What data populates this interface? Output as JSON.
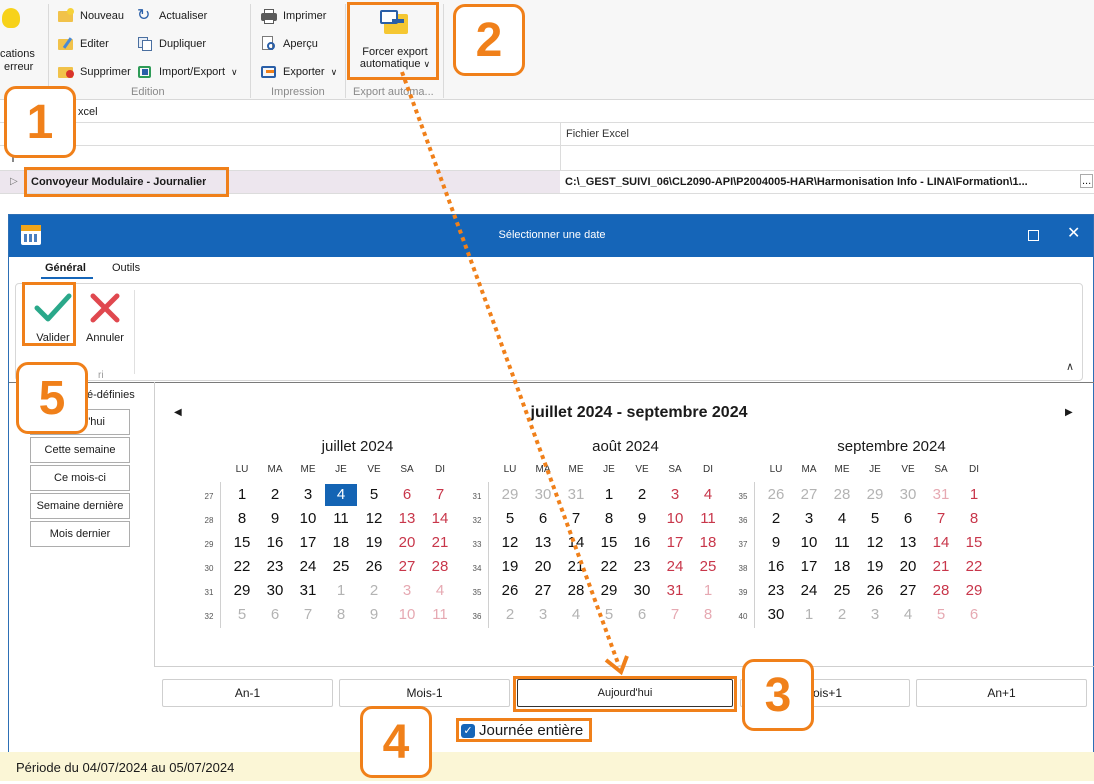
{
  "ribbon": {
    "left_btn_line1": "cations",
    "left_btn_line2": "erreur",
    "edition": {
      "nouveau": "Nouveau",
      "editer": "Editer",
      "supprimer": "Supprimer",
      "actualiser": "Actualiser",
      "dupliquer": "Dupliquer",
      "import_export": "Import/Export",
      "group_label": "Edition"
    },
    "impression": {
      "imprimer": "Imprimer",
      "apercu": "Aperçu",
      "exporter": "Exporter",
      "group_label": "Impression"
    },
    "export_auto": {
      "line1": "Forcer export",
      "line2": "automatique",
      "group_label": "Export automa..."
    }
  },
  "grid": {
    "filter_text": "xcel",
    "col_fichier": "Fichier Excel",
    "row_name": "Convoyeur Modulaire - Journalier",
    "row_path": "C:\\_GEST_SUIVI_06\\CL2090-API\\P2004005-HAR\\Harmonisation Info - LINA\\Formation\\1...",
    "row_more": "..."
  },
  "dialog": {
    "title": "Sélectionner une date",
    "tab_general": "Général",
    "tab_outils": "Outils",
    "valider": "Valider",
    "annuler": "Annuler",
    "group_frag": "ri",
    "predefined_header": "é-définies",
    "quick_buttons": [
      "l'hui",
      "Cette semaine",
      "Ce mois-ci",
      "Semaine dernière",
      "Mois dernier"
    ],
    "range_title": "juillet 2024 - septembre 2024",
    "weekdays": [
      "LU",
      "MA",
      "ME",
      "JE",
      "VE",
      "SA",
      "DI"
    ],
    "nav": {
      "an_minus": "An-1",
      "mois_minus": "Mois-1",
      "aujourdhui": "Aujourd'hui",
      "mois_plus": "ois+1",
      "an_plus": "An+1"
    },
    "journee_entiere": "Journée entière",
    "status": "Période du 04/07/2024 au 05/07/2024"
  },
  "months": [
    {
      "name": "juillet 2024",
      "weeks": [
        "27",
        "28",
        "29",
        "30",
        "31",
        "32"
      ],
      "days": [
        [
          "1",
          "2",
          "3",
          "4",
          "5",
          "6",
          "7"
        ],
        [
          "8",
          "9",
          "10",
          "11",
          "12",
          "13",
          "14"
        ],
        [
          "15",
          "16",
          "17",
          "18",
          "19",
          "20",
          "21"
        ],
        [
          "22",
          "23",
          "24",
          "25",
          "26",
          "27",
          "28"
        ],
        [
          "29",
          "30",
          "31",
          "1",
          "2",
          "3",
          "4"
        ],
        [
          "5",
          "6",
          "7",
          "8",
          "9",
          "10",
          "11"
        ]
      ],
      "first_other_row": 4,
      "first_other_col": 3,
      "selected": [
        0,
        3
      ]
    },
    {
      "name": "août 2024",
      "weeks": [
        "31",
        "32",
        "33",
        "34",
        "35",
        "36"
      ],
      "days": [
        [
          "29",
          "30",
          "31",
          "1",
          "2",
          "3",
          "4"
        ],
        [
          "5",
          "6",
          "7",
          "8",
          "9",
          "10",
          "11"
        ],
        [
          "12",
          "13",
          "14",
          "15",
          "16",
          "17",
          "18"
        ],
        [
          "19",
          "20",
          "21",
          "22",
          "23",
          "24",
          "25"
        ],
        [
          "26",
          "27",
          "28",
          "29",
          "30",
          "31",
          "1"
        ],
        [
          "2",
          "3",
          "4",
          "5",
          "6",
          "7",
          "8"
        ]
      ],
      "lead_other": 3,
      "first_other_row": 4,
      "first_other_col": 6
    },
    {
      "name": "septembre 2024",
      "weeks": [
        "35",
        "36",
        "37",
        "38",
        "39",
        "40"
      ],
      "days": [
        [
          "26",
          "27",
          "28",
          "29",
          "30",
          "31",
          "1"
        ],
        [
          "2",
          "3",
          "4",
          "5",
          "6",
          "7",
          "8"
        ],
        [
          "9",
          "10",
          "11",
          "12",
          "13",
          "14",
          "15"
        ],
        [
          "16",
          "17",
          "18",
          "19",
          "20",
          "21",
          "22"
        ],
        [
          "23",
          "24",
          "25",
          "26",
          "27",
          "28",
          "29"
        ],
        [
          "30",
          "1",
          "2",
          "3",
          "4",
          "5",
          "6"
        ]
      ],
      "lead_other": 6,
      "first_other_row": 5,
      "first_other_col": 1
    }
  ],
  "callouts": [
    "1",
    "2",
    "3",
    "4",
    "5"
  ],
  "colors": {
    "accent": "#f0801a",
    "titlebar": "#1565b8",
    "weekend": "#c8364a",
    "selected": "#1464b4"
  }
}
